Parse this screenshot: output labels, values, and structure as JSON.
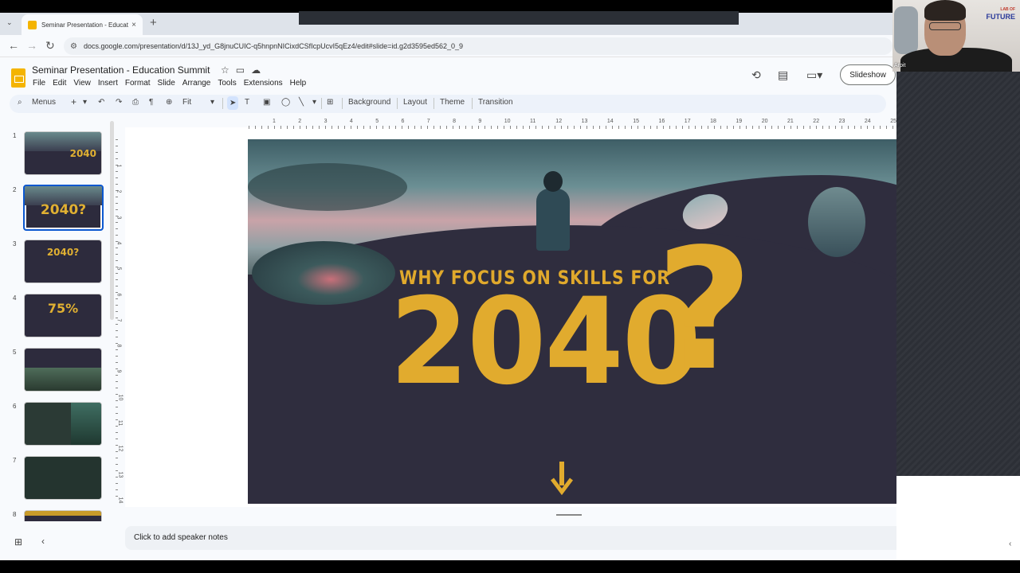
{
  "browser": {
    "tab_title": "Seminar Presentation - Educatio",
    "tab_close": "×",
    "tab_dropdown": "⌄",
    "new_tab": "+",
    "back": "←",
    "forward": "→",
    "reload": "↻",
    "site_settings": "⚙",
    "url": "docs.google.com/presentation/d/13J_yd_G8jnuCUIC-q5hnpnNICixdCSfIcpUcvI5qEz4/edit#slide=id.g2d3595ed562_0_9"
  },
  "doc": {
    "title": "Seminar Presentation - Education Summit",
    "menu": [
      "File",
      "Edit",
      "View",
      "Insert",
      "Format",
      "Slide",
      "Arrange",
      "Tools",
      "Extensions",
      "Help"
    ],
    "slideshow_label": "Slideshow"
  },
  "toolbar": {
    "search_label": "Menus",
    "zoom_label": "Fit",
    "background": "Background",
    "layout": "Layout",
    "theme": "Theme",
    "transition": "Transition"
  },
  "ruler": {
    "h_labels": [
      "1",
      "2",
      "3",
      "4",
      "5",
      "6",
      "7",
      "8",
      "9",
      "10",
      "11",
      "12",
      "13",
      "14",
      "15",
      "16",
      "17",
      "18",
      "19",
      "20",
      "21",
      "22",
      "23",
      "24",
      "25"
    ],
    "v_labels": [
      "1",
      "2",
      "3",
      "4",
      "5",
      "6",
      "7",
      "8",
      "9",
      "10",
      "11",
      "12",
      "13",
      "14"
    ]
  },
  "filmstrip": {
    "thumbnails": [
      {
        "num": "1",
        "text": "2040"
      },
      {
        "num": "2",
        "text": "2040?"
      },
      {
        "num": "3",
        "text": "2040?"
      },
      {
        "num": "4",
        "text": "75%"
      },
      {
        "num": "5",
        "text": ""
      },
      {
        "num": "6",
        "text": ""
      },
      {
        "num": "7",
        "text": ""
      },
      {
        "num": "8",
        "text": ""
      }
    ],
    "selected_index": 2
  },
  "slide": {
    "headline": "WHY FOCUS ON SKILLS FOR",
    "big_text": "2040",
    "question_mark": "?"
  },
  "notes": {
    "placeholder": "Click to add speaker notes"
  },
  "webcam": {
    "logo_top": "LAB OF",
    "logo_bottom": "FUTURE",
    "name": "Arpit"
  },
  "colors": {
    "accent_gold": "#e1ab2e",
    "slide_bg": "#2b2a38",
    "selection_blue": "#0b57d0",
    "slides_yellow": "#f4b400"
  },
  "icons": {
    "star": "star-icon",
    "folder": "move-folder-icon",
    "cloud": "cloud-status-icon",
    "history": "version-history-icon",
    "comments": "comments-icon",
    "camera": "meet-camera-icon"
  }
}
